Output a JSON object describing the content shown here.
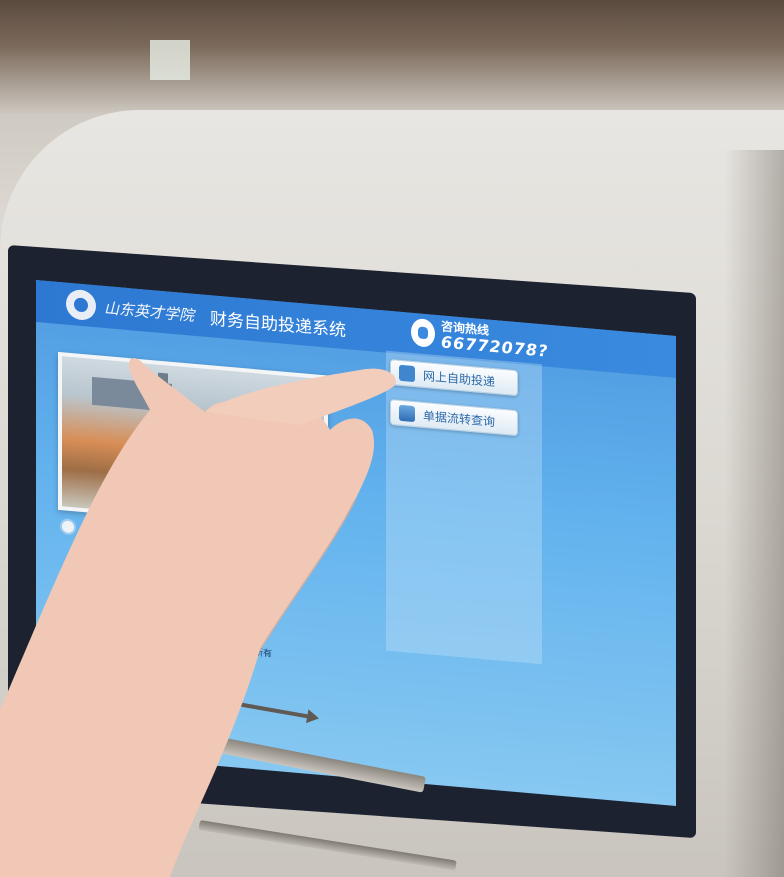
{
  "kiosk_screen": {
    "school_name": "山东英才学院",
    "system_title": "财务自助投递系统",
    "hotline_label": "咨询热线",
    "hotline_number": "66772078?",
    "buttons": [
      {
        "label": "网上自助投递",
        "icon": "online-submit-icon"
      },
      {
        "label": "单据流转查询",
        "icon": "document-query-icon"
      }
    ],
    "footer": "所有"
  },
  "colors": {
    "screen_blue": "#4f9ae0",
    "header_blue": "#2d78d2",
    "bezel": "#1d2230",
    "kiosk_body": "#e3e0da",
    "skin": "#f1c8b6"
  }
}
